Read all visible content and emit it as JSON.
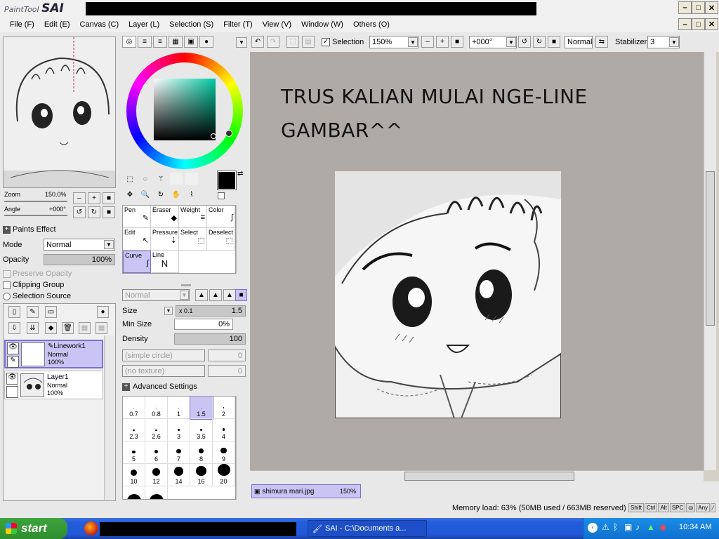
{
  "app": {
    "logo_small": "PaintTool",
    "logo_big": "SAI"
  },
  "window_buttons": [
    "–",
    "□",
    "✕"
  ],
  "menu": [
    "File (F)",
    "Edit (E)",
    "Canvas (C)",
    "Layer (L)",
    "Selection (S)",
    "Filter (T)",
    "View (V)",
    "Window (W)",
    "Others (O)"
  ],
  "navigator": {
    "zoom_label": "Zoom",
    "zoom_value": "150.0%",
    "angle_label": "Angle",
    "angle_value": "+000°"
  },
  "layer_props": {
    "paints_effect": "Paints Effect",
    "mode_label": "Mode",
    "mode_value": "Normal",
    "opacity_label": "Opacity",
    "opacity_value": "100%",
    "preserve_opacity": "Preserve Opacity",
    "clipping_group": "Clipping Group",
    "selection_source": "Selection Source"
  },
  "layers": [
    {
      "name": "Linework1",
      "mode": "Normal",
      "opacity": "100%",
      "selected": true
    },
    {
      "name": "Layer1",
      "mode": "Normal",
      "opacity": "100%",
      "selected": false
    }
  ],
  "tools": {
    "pen": "Pen",
    "eraser": "Eraser",
    "weight": "Weight",
    "color": "Color",
    "edit": "Edit",
    "pressure": "Pressure",
    "select": "Select",
    "deselect": "Deselect",
    "curve": "Curve",
    "line": "Line"
  },
  "brush": {
    "mode": "Normal",
    "size_label": "Size",
    "size_mult": "x 0.1",
    "size_value": "1.5",
    "min_size_label": "Min Size",
    "min_size_value": "0%",
    "density_label": "Density",
    "density_value": "100",
    "shape": "(simple circle)",
    "shape_value": "0",
    "texture": "(no texture)",
    "texture_value": "0",
    "advanced": "Advanced Settings"
  },
  "brush_sizes": [
    "0.7",
    "0.8",
    "1",
    "1.5",
    "2",
    "2.3",
    "2.6",
    "3",
    "3.5",
    "4",
    "5",
    "6",
    "7",
    "8",
    "9",
    "10",
    "12",
    "14",
    "16",
    "20"
  ],
  "toolbar": {
    "selection_label": "Selection",
    "zoom": "150%",
    "angle": "+000°",
    "blend": "Normal",
    "stabilizer_label": "Stabilizer",
    "stabilizer_value": "3"
  },
  "canvas": {
    "caption_line1": "TRUS KALIAN MULAI NGE-LINE",
    "caption_line2": "GAMBAR^^"
  },
  "document_tab": {
    "name": "shimura mari.jpg",
    "zoom": "150%"
  },
  "status": {
    "memory": "Memory load: 63% (50MB used / 663MB reserved)",
    "keys": [
      "Shift",
      "Ctrl",
      "Alt",
      "SPC",
      "◎",
      "Any",
      "∕"
    ]
  },
  "taskbar": {
    "start": "start",
    "task": "SAI - C:\\Documents a...",
    "clock": "10:34 AM"
  }
}
